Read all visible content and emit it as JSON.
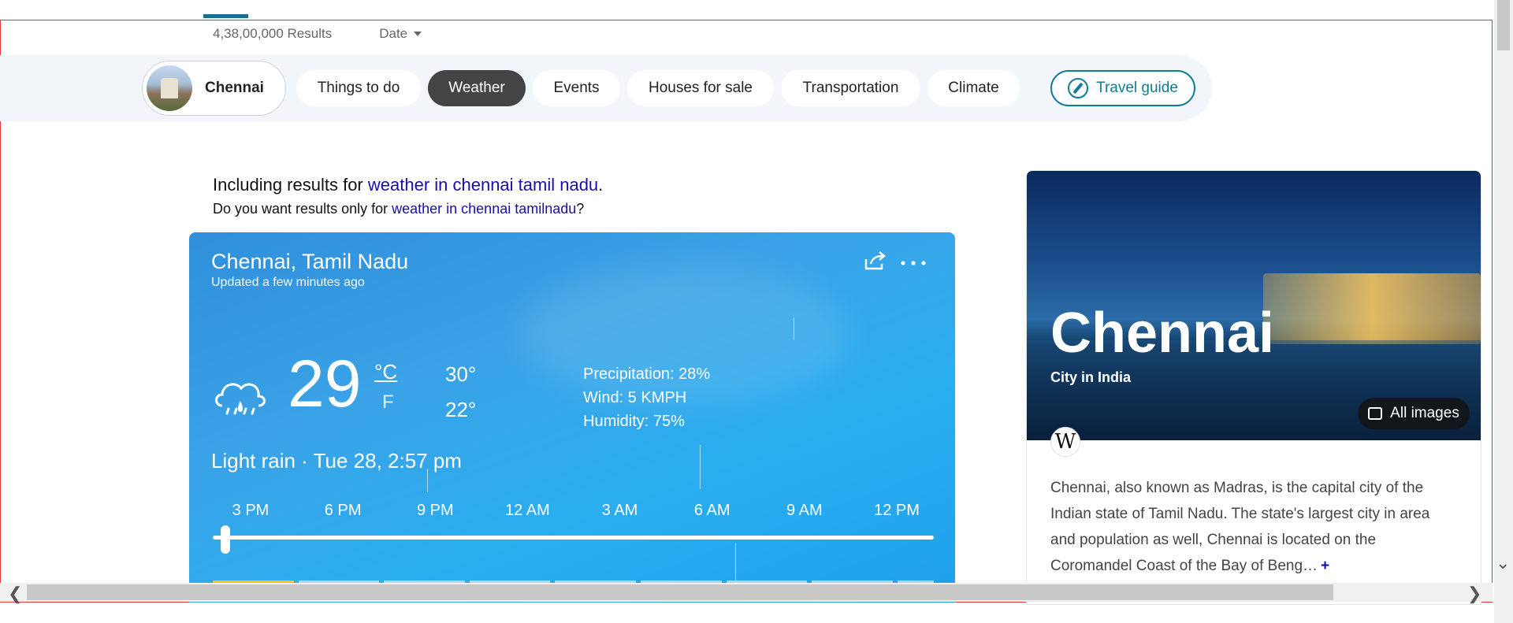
{
  "results": {
    "count": "4,38,00,000 Results",
    "date_filter": "Date"
  },
  "chips": {
    "city": "Chennai",
    "items": [
      "Things to do",
      "Weather",
      "Events",
      "Houses for sale",
      "Transportation",
      "Climate"
    ],
    "active": "Weather",
    "travel_guide": "Travel guide"
  },
  "spell": {
    "including_prefix": "Including results for ",
    "including_link": "weather in chennai tamil nadu",
    "including_suffix": ".",
    "doyou_prefix": "Do you want results only for ",
    "doyou_link": "weather in chennai tamilnadu",
    "doyou_suffix": "?"
  },
  "weather": {
    "location": "Chennai, Tamil Nadu",
    "updated": "Updated a few minutes ago",
    "temperature": "29",
    "unit_c": "°C",
    "unit_f": "F",
    "high": "30°",
    "low": "22°",
    "precipitation": "Precipitation: 28%",
    "wind": "Wind: 5 KMPH",
    "humidity": "Humidity: 75%",
    "condition": "Light rain · Tue 28, 2:57 pm",
    "times": [
      "3 PM",
      "6 PM",
      "9 PM",
      "12 AM",
      "3 AM",
      "6 AM",
      "9 AM",
      "12 PM"
    ],
    "share_icon": "share-icon",
    "more_icon": "more-icon",
    "condition_icon": "cloud-rain-icon"
  },
  "card": {
    "title": "Chennai",
    "subtitle": "City in India",
    "all_images": "All images",
    "wiki_letter": "W",
    "description": "Chennai, also known as Madras, is the capital city of the Indian state of Tamil Nadu. The state's largest city in area and population as well, Chennai is located on the Coromandel Coast of the Bay of Beng…",
    "more": "+"
  },
  "colors": {
    "accent": "#0f7c95",
    "link": "#1a0dab",
    "active_chip": "#444444",
    "frame": "#e53935"
  }
}
